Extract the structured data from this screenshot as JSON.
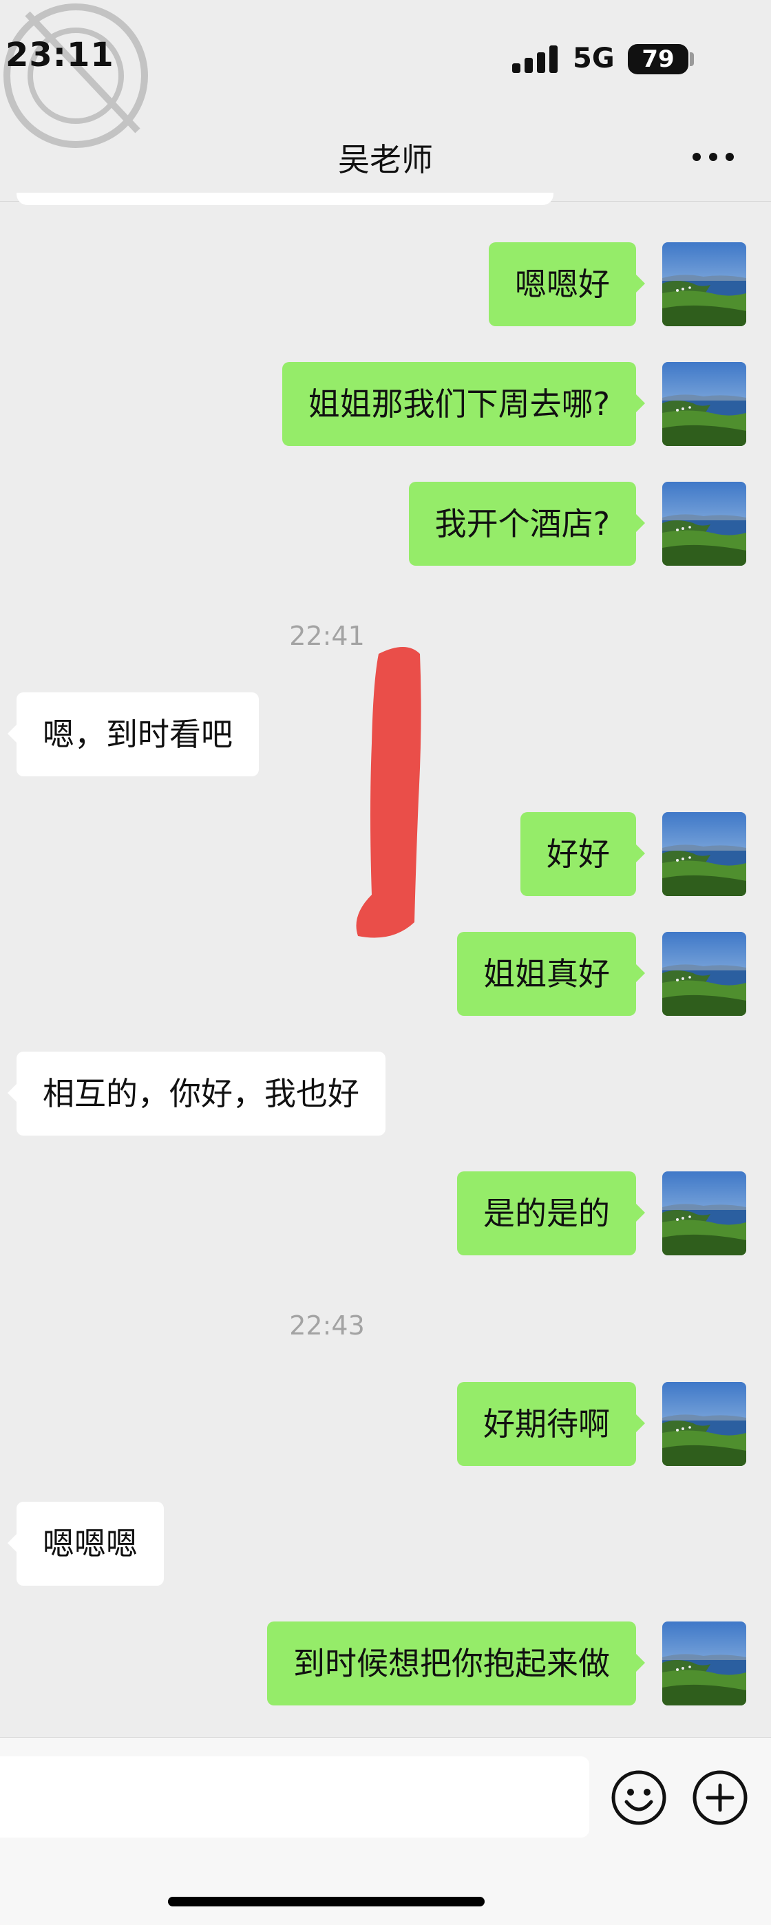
{
  "status_bar": {
    "time": "23:11",
    "network": "5G",
    "battery": "79"
  },
  "chat": {
    "title": "吴老师"
  },
  "messages": [
    {
      "side": "out",
      "text": "嗯嗯好"
    },
    {
      "side": "out",
      "text": "姐姐那我们下周去哪?"
    },
    {
      "side": "out",
      "text": "我开个酒店?"
    },
    {
      "type": "time",
      "text": "22:41"
    },
    {
      "side": "in",
      "text": "嗯，到时看吧"
    },
    {
      "side": "out",
      "text": "好好"
    },
    {
      "side": "out",
      "text": "姐姐真好"
    },
    {
      "side": "in",
      "text": "相互的，你好，我也好"
    },
    {
      "side": "out",
      "text": "是的是的"
    },
    {
      "type": "time",
      "text": "22:43"
    },
    {
      "side": "out",
      "text": "好期待啊"
    },
    {
      "side": "in",
      "text": "嗯嗯嗯"
    },
    {
      "side": "out",
      "text": "到时候想把你抱起来做"
    }
  ],
  "icons": {
    "more": "more-dots-icon",
    "emoji": "emoji-icon",
    "plus": "plus-circle-icon",
    "avatar": "landscape-avatar"
  },
  "colors": {
    "outgoing_bubble": "#95ec69",
    "incoming_bubble": "#ffffff",
    "background": "#ededed"
  }
}
